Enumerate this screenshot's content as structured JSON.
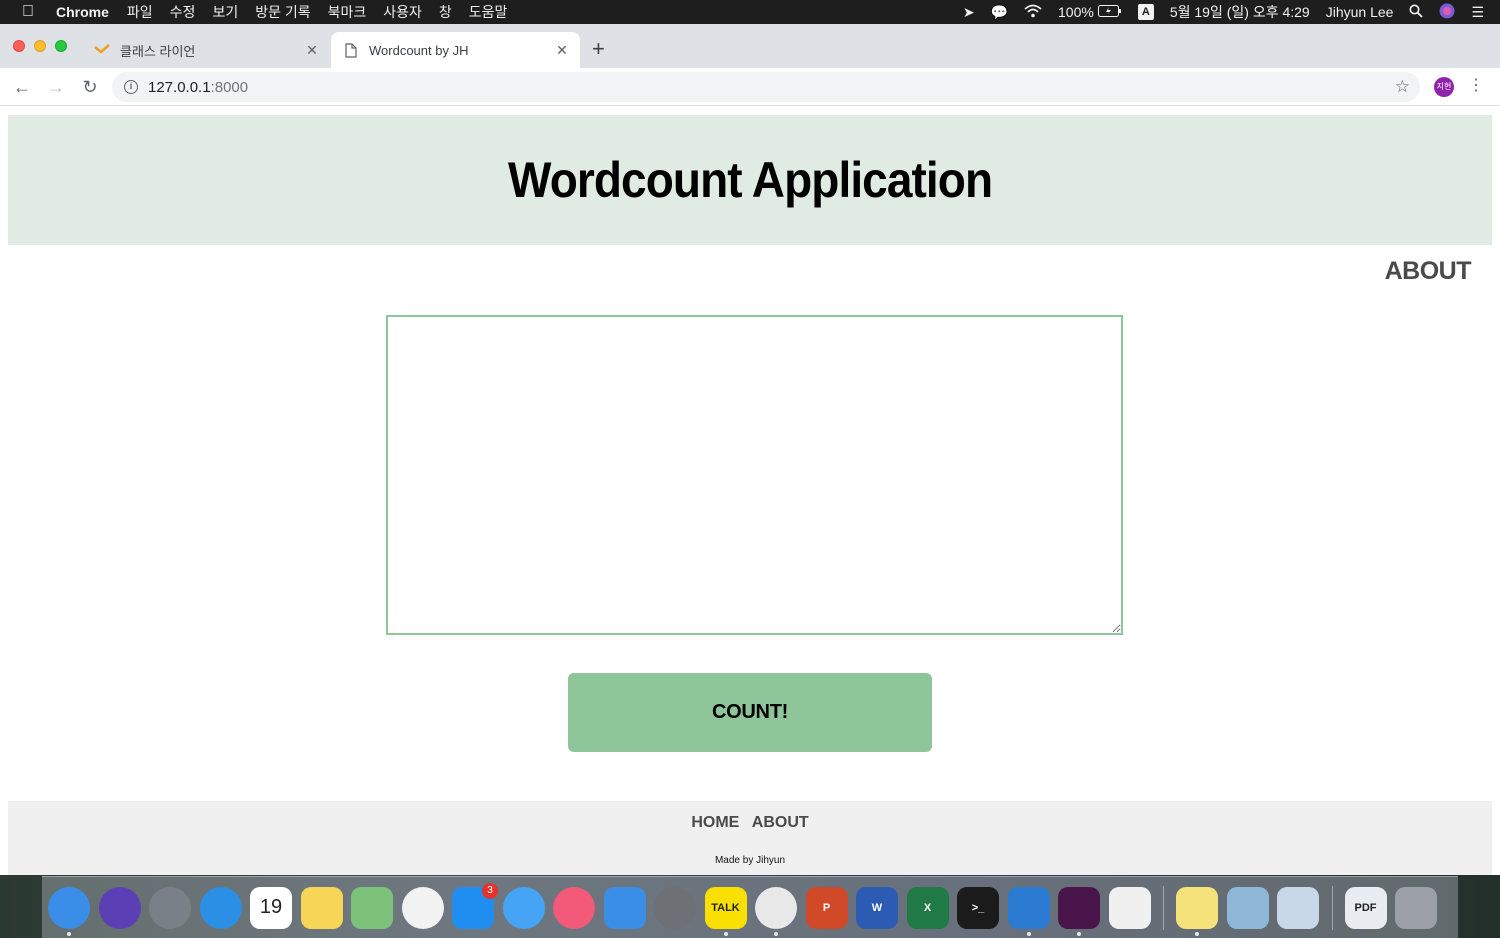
{
  "menubar": {
    "app_name": "Chrome",
    "menus": [
      "파일",
      "수정",
      "보기",
      "방문 기록",
      "북마크",
      "사용자",
      "창",
      "도움말"
    ],
    "battery": "100%",
    "input_source": "A",
    "datetime": "5월 19일 (일) 오후 4:29",
    "user": "Jihyun Lee"
  },
  "browser": {
    "tabs": [
      {
        "title": "클래스 라이언",
        "active": false
      },
      {
        "title": "Wordcount by JH",
        "active": true
      }
    ],
    "url_host": "127.0.0.1",
    "url_port": ":8000",
    "profile_initials": "지현"
  },
  "page": {
    "title": "Wordcount Application",
    "about_link": "ABOUT",
    "textarea_value": "",
    "count_button": "COUNT!",
    "footer": {
      "home": "HOME",
      "about": "ABOUT",
      "credit": "Made by Jihyun"
    }
  },
  "colors": {
    "hero_bg": "#e0ebe3",
    "accent_green": "#8ec599",
    "footer_bg": "#f0f0f0"
  },
  "dock": {
    "apps": [
      {
        "name": "finder-icon",
        "label": "",
        "color": "#3b8ee8",
        "running": true
      },
      {
        "name": "siri-icon",
        "label": "",
        "color": "#5a3fb5",
        "running": false
      },
      {
        "name": "launchpad-icon",
        "label": "",
        "color": "#7a8087",
        "running": false
      },
      {
        "name": "safari-icon",
        "label": "",
        "color": "#2b8fe6",
        "running": false
      },
      {
        "name": "calendar-icon",
        "label": "19",
        "color": "#ffffff",
        "running": false
      },
      {
        "name": "notes-icon",
        "label": "",
        "color": "#f7d557",
        "running": false
      },
      {
        "name": "maps-icon",
        "label": "",
        "color": "#7cc27a",
        "running": false
      },
      {
        "name": "photos-icon",
        "label": "",
        "color": "#f2f2f2",
        "running": false
      },
      {
        "name": "app-store-icon",
        "label": "",
        "color": "#1f8ef0",
        "running": false,
        "badge": "3"
      },
      {
        "name": "messages-icon",
        "label": "",
        "color": "#45a4f5",
        "running": false
      },
      {
        "name": "itunes-icon",
        "label": "",
        "color": "#f35a7a",
        "running": false
      },
      {
        "name": "xcode-icon",
        "label": "",
        "color": "#3a8ee6",
        "running": false
      },
      {
        "name": "system-preferences-icon",
        "label": "",
        "color": "#6d7075",
        "running": false
      },
      {
        "name": "kakaotalk-icon",
        "label": "TALK",
        "color": "#f9e000",
        "running": true
      },
      {
        "name": "chrome-icon",
        "label": "",
        "color": "#e8e8e8",
        "running": true
      },
      {
        "name": "powerpoint-icon",
        "label": "P",
        "color": "#d04a2a",
        "running": false
      },
      {
        "name": "word-icon",
        "label": "W",
        "color": "#2b5bb3",
        "running": false
      },
      {
        "name": "excel-icon",
        "label": "X",
        "color": "#1f7a45",
        "running": false
      },
      {
        "name": "terminal-icon",
        "label": ">_",
        "color": "#1b1b1b",
        "running": false
      },
      {
        "name": "vscode-icon",
        "label": "",
        "color": "#2a7bd1",
        "running": true
      },
      {
        "name": "slack-icon",
        "label": "",
        "color": "#4a154b",
        "running": true
      },
      {
        "name": "python-icon",
        "label": "",
        "color": "#f0f0f0",
        "running": false
      },
      {
        "name": "stickies-icon",
        "label": "",
        "color": "#f6e27a",
        "running": true
      },
      {
        "name": "preview-icon",
        "label": "",
        "color": "#8fb8d8",
        "running": false
      },
      {
        "name": "mail-stamp-icon",
        "label": "",
        "color": "#c8d8e8",
        "running": false
      },
      {
        "name": "pdf-document-icon",
        "label": "PDF",
        "color": "#e9edf2",
        "running": false
      },
      {
        "name": "trash-icon",
        "label": "",
        "color": "#9aa0a6",
        "running": false
      }
    ]
  }
}
